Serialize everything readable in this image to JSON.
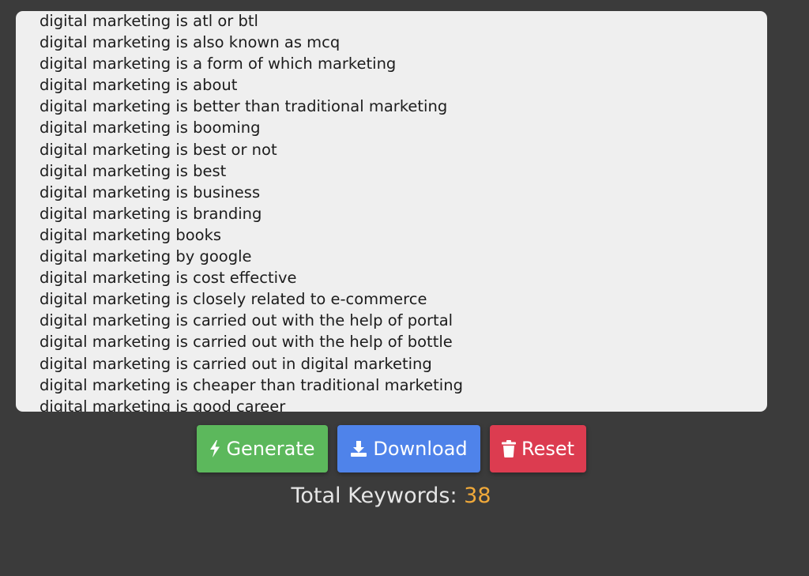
{
  "keywords": [
    "digital marketing is atl or btl",
    "digital marketing is also known as mcq",
    "digital marketing is a form of which marketing",
    "digital marketing is about",
    "digital marketing is better than traditional marketing",
    "digital marketing is booming",
    "digital marketing is best or not",
    "digital marketing is best",
    "digital marketing is business",
    "digital marketing is branding",
    "digital marketing books",
    "digital marketing by google",
    "digital marketing is cost effective",
    "digital marketing is closely related to e-commerce",
    "digital marketing is carried out with the help of portal",
    "digital marketing is carried out with the help of bottle",
    "digital marketing is carried out in digital marketing",
    "digital marketing is cheaper than traditional marketing",
    "digital marketing is good career"
  ],
  "buttons": {
    "generate_label": "Generate",
    "download_label": "Download",
    "reset_label": "Reset"
  },
  "icons": {
    "generate": "bolt-icon",
    "download": "download-icon",
    "reset": "trash-icon"
  },
  "stats": {
    "total_label": "Total Keywords:",
    "total_count": "38"
  },
  "colors": {
    "generate": "#5cb85c",
    "download": "#4f83ea",
    "reset": "#dc3c50",
    "count": "#f0a93a",
    "background": "#3b3b3b"
  }
}
